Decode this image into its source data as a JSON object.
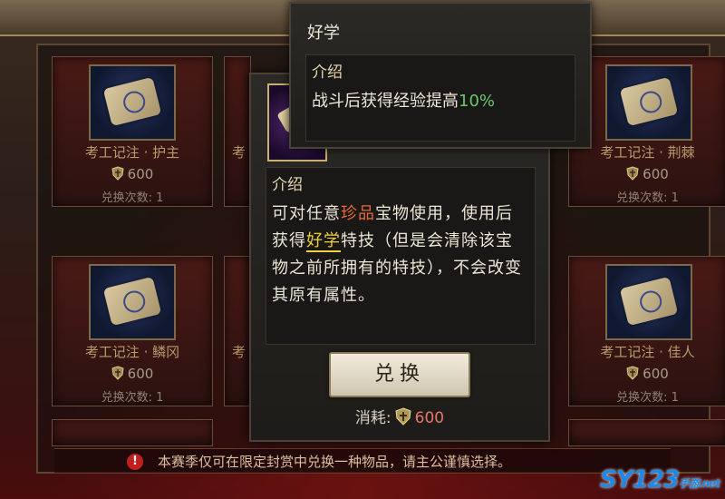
{
  "cards": [
    {
      "name": "考工记注 · 护主",
      "cost": "600",
      "times": "兑换次数: 1"
    },
    {
      "name": "考工记注 · 荆棘",
      "cost": "600",
      "times": "兑换次数: 1"
    },
    {
      "name": "考工记注 · 鳞冈",
      "cost": "600",
      "times": "兑换次数: 1"
    },
    {
      "name": "考工记注 · 佳人",
      "cost": "600",
      "times": "兑换次数: 1"
    }
  ],
  "partial_label": "考",
  "notice": "本赛季仅可在限定封赏中兑换一种物品，请主公谨慎选择。",
  "tooltip": {
    "desc_head": "介绍",
    "desc_p1": "可对任意",
    "desc_hl1": "珍品",
    "desc_p2": "宝物使用，使用后获得",
    "desc_hl2": "好学",
    "desc_p3": "特技（但是会清除该宝物之前所拥有的特技），不会改变其原有属性。",
    "button": "兑换",
    "cost_label": "消耗:",
    "cost_value": "600"
  },
  "skill_tip": {
    "title": "好学",
    "head": "介绍",
    "body_text": "战斗后获得经验提高",
    "body_value": "10%"
  },
  "watermark": {
    "main": "SY123",
    "sub": "手游",
    "domain": ".net"
  }
}
